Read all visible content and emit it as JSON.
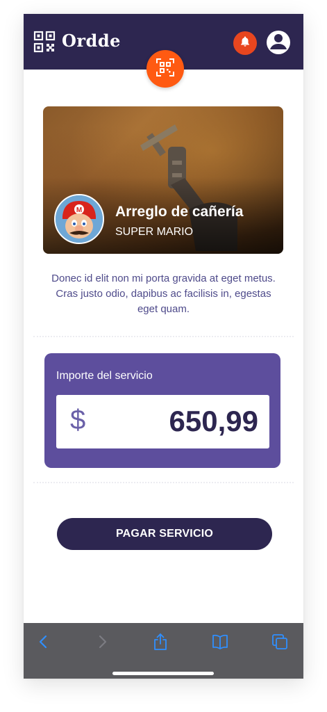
{
  "app": {
    "name": "Ordde"
  },
  "header": {
    "logo_icon": "qr-code-icon",
    "notification_icon": "bell-icon",
    "profile_icon": "user-icon",
    "scan_icon": "qr-scan-icon"
  },
  "service": {
    "title": "Arreglo de cañería",
    "provider": "SUPER MARIO",
    "description": "Donec id elit non mi porta gravida at eget metus. Cras justo odio, dapibus ac facilisis in, egestas eget quam."
  },
  "amount": {
    "label": "Importe del servicio",
    "currency": "$",
    "value": "650,99"
  },
  "pay_button": {
    "label": "PAGAR SERVICIO"
  },
  "browser_bar": {
    "icons": [
      "back-icon",
      "forward-icon",
      "share-icon",
      "bookmarks-icon",
      "tabs-icon"
    ]
  },
  "colors": {
    "header": "#2d2650",
    "accent": "#ff5a12",
    "bell": "#e8461f",
    "card": "#5d4e9d",
    "text": "#4e4a8a"
  }
}
